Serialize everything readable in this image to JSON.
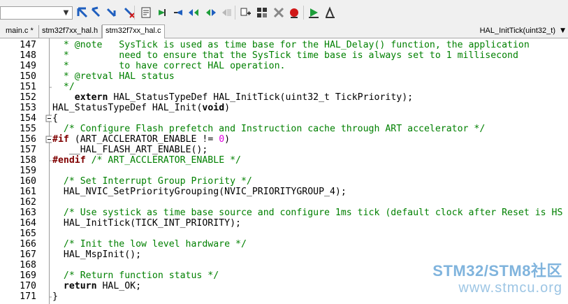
{
  "toolbar": {
    "combo_value": "",
    "icons": [
      "bookmark-set-icon",
      "bookmark-prev-icon",
      "bookmark-next-icon",
      "bookmark-clear-icon",
      "find-in-files-icon",
      "indent-icon",
      "unindent-icon",
      "comment-icon",
      "uncomment-icon",
      "disabled-icon",
      "build-target-icon",
      "rebuild-icon",
      "stop-build-icon",
      "debug-icon",
      "download-icon",
      "batch-build-icon"
    ],
    "colors": {
      "accent_blue": "#1f5fbf",
      "green": "#1e9e3a",
      "red": "#d01818"
    }
  },
  "tabs": [
    {
      "label": "main.c *",
      "active": false
    },
    {
      "label": "stm32f7xx_hal.h",
      "active": false
    },
    {
      "label": "stm32f7xx_hal.c",
      "active": true
    }
  ],
  "function_selector": {
    "value": "HAL_InitTick(uint32_t)"
  },
  "editor": {
    "lines": [
      {
        "n": "147",
        "fold": "line",
        "parts": [
          {
            "t": "  * @note   SysTick is used as time base for the HAL_Delay() function, the application",
            "c": "comment"
          }
        ]
      },
      {
        "n": "148",
        "fold": "line",
        "parts": [
          {
            "t": "  *         need to ensure that the SysTick time base is always set to 1 millisecond",
            "c": "comment"
          }
        ]
      },
      {
        "n": "149",
        "fold": "line",
        "parts": [
          {
            "t": "  *         to have correct HAL operation.",
            "c": "comment"
          }
        ]
      },
      {
        "n": "150",
        "fold": "line",
        "parts": [
          {
            "t": "  * @retval HAL status",
            "c": "comment"
          }
        ]
      },
      {
        "n": "151",
        "fold": "end",
        "parts": [
          {
            "t": "  */",
            "c": "comment"
          }
        ]
      },
      {
        "n": "152",
        "fold": "",
        "parts": [
          {
            "t": "    ",
            "c": "plain"
          },
          {
            "t": "extern",
            "c": "kw"
          },
          {
            "t": " HAL_StatusTypeDef HAL_InitTick(uint32_t TickPriority);",
            "c": "plain"
          }
        ]
      },
      {
        "n": "153",
        "fold": "",
        "parts": [
          {
            "t": "HAL_StatusTypeDef HAL_Init(",
            "c": "plain"
          },
          {
            "t": "void",
            "c": "kw"
          },
          {
            "t": ")",
            "c": "plain"
          }
        ]
      },
      {
        "n": "154",
        "fold": "open",
        "parts": [
          {
            "t": "{",
            "c": "plain"
          }
        ]
      },
      {
        "n": "155",
        "fold": "line",
        "parts": [
          {
            "t": "  /* Configure Flash prefetch and Instruction cache through ART accelerator */",
            "c": "comment"
          }
        ]
      },
      {
        "n": "156",
        "fold": "open",
        "parts": [
          {
            "t": "#if",
            "c": "pre"
          },
          {
            "t": " (ART_ACCLERATOR_ENABLE != ",
            "c": "plain"
          },
          {
            "t": "0",
            "c": "num"
          },
          {
            "t": ")",
            "c": "plain"
          }
        ]
      },
      {
        "n": "157",
        "fold": "line",
        "parts": [
          {
            "t": "   __HAL_FLASH_ART_ENABLE();",
            "c": "plain"
          }
        ]
      },
      {
        "n": "158",
        "fold": "end",
        "parts": [
          {
            "t": "#endif",
            "c": "pre"
          },
          {
            "t": " /* ART_ACCLERATOR_ENABLE */",
            "c": "comment"
          }
        ]
      },
      {
        "n": "159",
        "fold": "line",
        "parts": [
          {
            "t": "",
            "c": "plain"
          }
        ]
      },
      {
        "n": "160",
        "fold": "line",
        "parts": [
          {
            "t": "  /* Set Interrupt Group Priority */",
            "c": "comment"
          }
        ]
      },
      {
        "n": "161",
        "fold": "line",
        "parts": [
          {
            "t": "  HAL_NVIC_SetPriorityGrouping(NVIC_PRIORITYGROUP_4);",
            "c": "plain"
          }
        ]
      },
      {
        "n": "162",
        "fold": "line",
        "parts": [
          {
            "t": "",
            "c": "plain"
          }
        ]
      },
      {
        "n": "163",
        "fold": "line",
        "parts": [
          {
            "t": "  /* Use systick as time base source and configure 1ms tick (default clock after Reset is HS",
            "c": "comment"
          }
        ]
      },
      {
        "n": "164",
        "fold": "line",
        "parts": [
          {
            "t": "  HAL_InitTick(TICK_INT_PRIORITY);",
            "c": "plain"
          }
        ]
      },
      {
        "n": "165",
        "fold": "line",
        "parts": [
          {
            "t": "",
            "c": "plain"
          }
        ]
      },
      {
        "n": "166",
        "fold": "line",
        "parts": [
          {
            "t": "  /* Init the low level hardware */",
            "c": "comment"
          }
        ]
      },
      {
        "n": "167",
        "fold": "line",
        "parts": [
          {
            "t": "  HAL_MspInit();",
            "c": "plain"
          }
        ]
      },
      {
        "n": "168",
        "fold": "line",
        "parts": [
          {
            "t": "",
            "c": "plain"
          }
        ]
      },
      {
        "n": "169",
        "fold": "line",
        "parts": [
          {
            "t": "  /* Return function status */",
            "c": "comment"
          }
        ]
      },
      {
        "n": "170",
        "fold": "line",
        "parts": [
          {
            "t": "  ",
            "c": "plain"
          },
          {
            "t": "return",
            "c": "kw"
          },
          {
            "t": " HAL_OK;",
            "c": "plain"
          }
        ]
      },
      {
        "n": "171",
        "fold": "end",
        "parts": [
          {
            "t": "}",
            "c": "plain"
          }
        ]
      }
    ]
  },
  "watermark": {
    "line1": "STM32/STM8社区",
    "line2": "www.stmcu.org"
  }
}
